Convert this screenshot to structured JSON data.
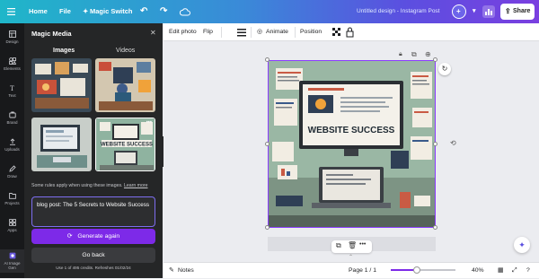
{
  "topbar": {
    "home": "Home",
    "file": "File",
    "magic_switch": "Magic Switch",
    "doc_title": "Untitled design - Instagram Post",
    "share": "Share"
  },
  "rail": {
    "items": [
      {
        "label": "Design",
        "icon": "layout-icon"
      },
      {
        "label": "Elements",
        "icon": "shapes-icon"
      },
      {
        "label": "Text",
        "icon": "text-icon"
      },
      {
        "label": "Brand",
        "icon": "brand-icon"
      },
      {
        "label": "Uploads",
        "icon": "upload-icon"
      },
      {
        "label": "Draw",
        "icon": "pen-icon"
      },
      {
        "label": "Projects",
        "icon": "folder-icon"
      },
      {
        "label": "Apps",
        "icon": "grid-icon"
      },
      {
        "label": "AI Image Gen",
        "icon": "ai-image-icon"
      }
    ]
  },
  "panel": {
    "title": "Magic Media",
    "tabs": [
      "Images",
      "Videos"
    ],
    "active_tab": "Images",
    "disclaimer": "Some rules apply when using these images.",
    "learn_more": "Learn more",
    "prompt_value": "blog post: The 5 Secrets to Website Success",
    "generate_again": "Generate again",
    "go_back": "Go back",
    "credits": "Use 1 of 495 credits. Refreshes 01/02/24"
  },
  "context_bar": {
    "edit_photo": "Edit photo",
    "flip": "Flip",
    "animate": "Animate",
    "position": "Position"
  },
  "canvas": {
    "image_headline": "WEBSITE SUCCESS"
  },
  "bottom": {
    "notes": "Notes",
    "page": "Page 1 / 1",
    "zoom": "40%",
    "zoom_level": 0.4
  },
  "colors": {
    "accent": "#7d2ae8",
    "panel_bg": "#252627",
    "rail_bg": "#18191b"
  }
}
